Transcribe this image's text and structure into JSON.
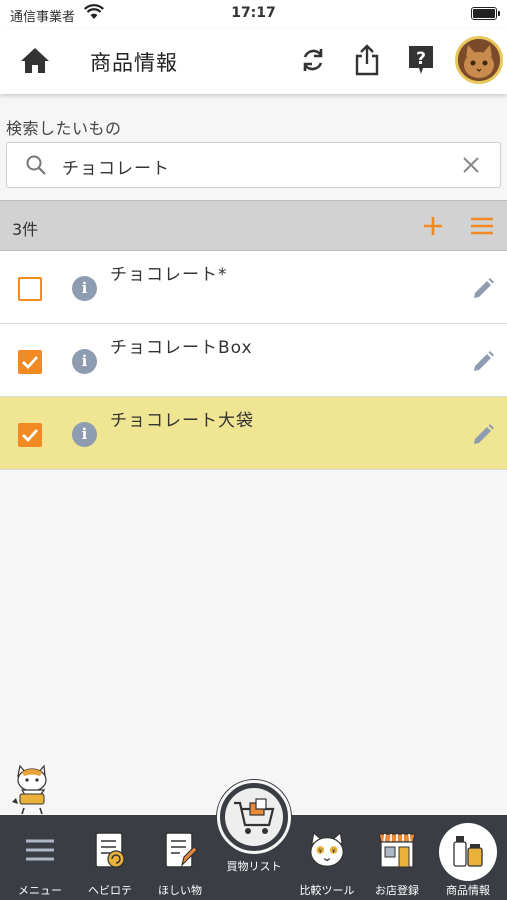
{
  "status_bar": {
    "carrier": "通信事業者",
    "time": "17:17"
  },
  "header": {
    "title": "商品情報",
    "icons": [
      "home-icon",
      "sync-icon",
      "share-icon",
      "help-icon",
      "avatar"
    ]
  },
  "search": {
    "label": "検索したいもの",
    "value": "チョコレート"
  },
  "list_header": {
    "count": "3件"
  },
  "items": [
    {
      "name": "チョコレート*",
      "checked": false,
      "highlight": false
    },
    {
      "name": "チョコレートBox",
      "checked": true,
      "highlight": false
    },
    {
      "name": "チョコレート大袋",
      "checked": true,
      "highlight": true
    }
  ],
  "tabs": {
    "menu": "メニュー",
    "frequent": "ヘビロテ",
    "wishlist": "ほしい物",
    "shopping_list": "買物リスト",
    "compare": "比較ツール",
    "stores": "お店登録",
    "products": "商品情報"
  },
  "colors": {
    "accent": "#f18a22",
    "highlight_row": "#efe592",
    "tabbar": "#3a3d44",
    "info": "#8d9cb0"
  }
}
